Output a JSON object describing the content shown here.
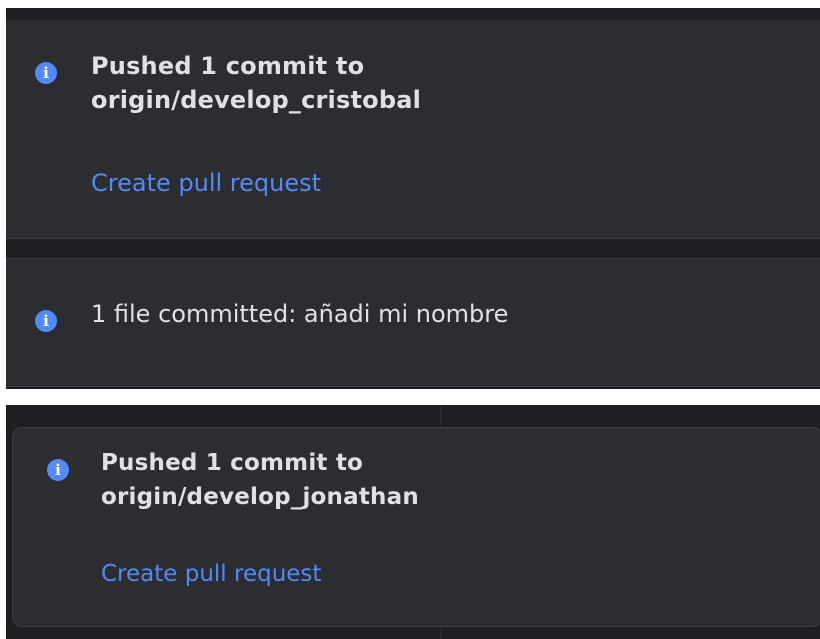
{
  "notifications": [
    {
      "icon": "info-icon",
      "title_line1": "Pushed 1 commit to",
      "title_line2": "origin/develop_cristobal",
      "action": "Create pull request"
    },
    {
      "icon": "info-icon",
      "message": "1 file committed: añadi mi nombre"
    },
    {
      "icon": "info-icon",
      "title_line1": "Pushed 1 commit to",
      "title_line2": "origin/develop_jonathan",
      "action": "Create pull request"
    }
  ],
  "colors": {
    "background": "#1e1f22",
    "card": "#2b2d30",
    "text": "#dfe1e5",
    "accent": "#548af7"
  }
}
